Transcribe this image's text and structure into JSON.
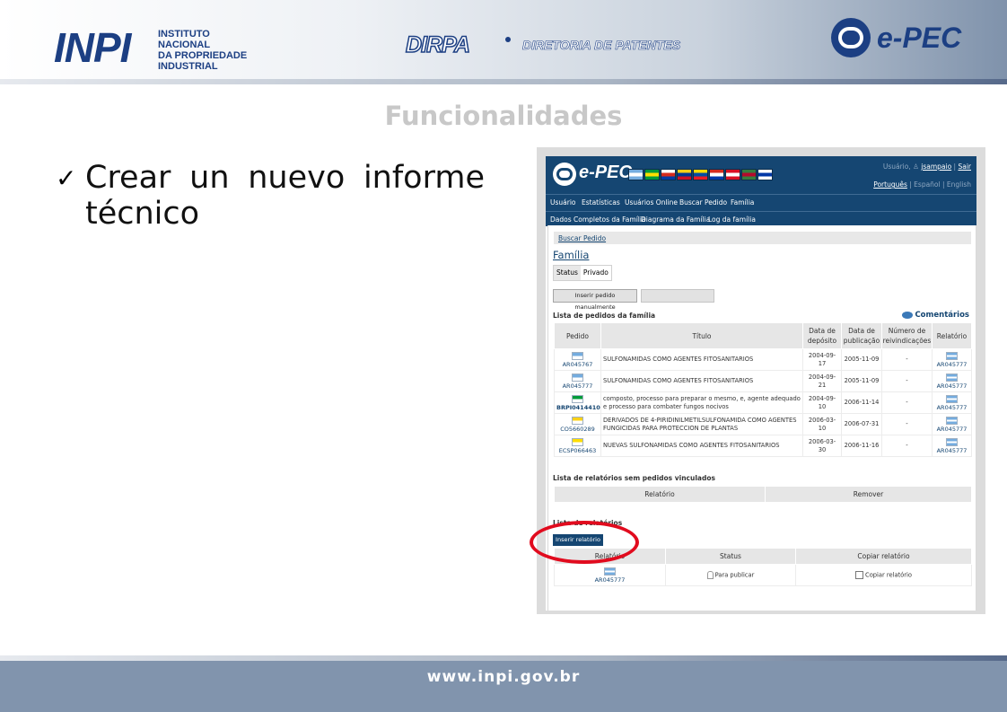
{
  "header": {
    "inpi_logo": "INPI",
    "inpi_lines": [
      "INSTITUTO",
      "NACIONAL",
      "DA PROPRIEDADE",
      "INDUSTRIAL"
    ],
    "dirpa": "DIRPA",
    "dirpa_sub": "DIRETORIA DE PATENTES",
    "epec": "e-PEC"
  },
  "slide": {
    "title": "Funcionalidades",
    "bullet": "Crear un nuevo informe técnico",
    "check_glyph": "✓"
  },
  "app": {
    "logo": "e-PEC",
    "flags": [
      {
        "country": "AR",
        "c1": "#74acdf",
        "c2": "#ffffff",
        "c3": "#74acdf"
      },
      {
        "country": "BR",
        "c1": "#009b3a",
        "c2": "#fedf00",
        "c3": "#009b3a"
      },
      {
        "country": "CL",
        "c1": "#ffffff",
        "c2": "#d52b1e",
        "c3": "#0039a6"
      },
      {
        "country": "CO",
        "c1": "#fcd116",
        "c2": "#003893",
        "c3": "#ce1126"
      },
      {
        "country": "EC",
        "c1": "#ffdd00",
        "c2": "#034ea2",
        "c3": "#ed1c24"
      },
      {
        "country": "PY",
        "c1": "#d52b1e",
        "c2": "#ffffff",
        "c3": "#0038a8"
      },
      {
        "country": "PE",
        "c1": "#d91023",
        "c2": "#ffffff",
        "c3": "#d91023"
      },
      {
        "country": "SR",
        "c1": "#377e3f",
        "c2": "#b40a2d",
        "c3": "#377e3f"
      },
      {
        "country": "UY",
        "c1": "#ffffff",
        "c2": "#0038a8",
        "c3": "#ffffff"
      }
    ],
    "user_label": "Usuário,",
    "user_name": "jsampaio",
    "logout": "Sair",
    "langs": {
      "pt": "Português",
      "es": "Español",
      "en": "English"
    },
    "menu1": [
      "Usuário",
      "Estatísticas",
      "Usuários Online",
      "Buscar Pedido",
      "Família"
    ],
    "menu2": [
      "Dados Completos da Família",
      "Diagrama da Família",
      "Log da família"
    ],
    "breadcrumb": "Buscar Pedido",
    "family_title": "Família",
    "status_label": "Status",
    "status_value": "Privado",
    "insert_pedido_btn": "Inserir pedido manualmente",
    "list_pedidos_title": "Lista de pedidos da família",
    "comments": "Comentários",
    "table": {
      "headers": [
        "Pedido",
        "Título",
        "Data de depósito",
        "Data de publicação",
        "Número de reivindicações",
        "Relatório"
      ],
      "rows": [
        {
          "pedido": "AR045767",
          "flag": "#74acdf",
          "bold": false,
          "titulo": "SULFONAMIDAS COMO AGENTES FITOSANITARIOS",
          "deposito": "2004-09-17",
          "publicacao": "2005-11-09",
          "reivindicacoes": "-",
          "relatorio": "AR045777"
        },
        {
          "pedido": "AR045777",
          "flag": "#74acdf",
          "bold": false,
          "titulo": "SULFONAMIDAS COMO AGENTES FITOSANITARIOS",
          "deposito": "2004-09-21",
          "publicacao": "2005-11-09",
          "reivindicacoes": "-",
          "relatorio": "AR045777"
        },
        {
          "pedido": "BRPI0414410",
          "flag": "#009b3a",
          "bold": true,
          "titulo": "composto, processo para preparar o mesmo, e, agente adequado e processo para combater fungos nocivos",
          "deposito": "2004-09-10",
          "publicacao": "2006-11-14",
          "reivindicacoes": "-",
          "relatorio": "AR045777"
        },
        {
          "pedido": "CO5660289",
          "flag": "#fcd116",
          "bold": false,
          "titulo": "DERIVADOS DE 4-PIRIDINILMETILSULFONAMIDA COMO AGENTES FUNGICIDAS PARA PROTECCION DE PLANTAS",
          "deposito": "2006-03-10",
          "publicacao": "2006-07-31",
          "reivindicacoes": "-",
          "relatorio": "AR045777"
        },
        {
          "pedido": "ECSP066463",
          "flag": "#ffdd00",
          "bold": false,
          "titulo": "NUEVAS SULFONAMIDAS COMO AGENTES FITOSANITARIOS",
          "deposito": "2006-03-30",
          "publicacao": "2006-11-16",
          "reivindicacoes": "-",
          "relatorio": "AR045777"
        }
      ]
    },
    "orphan_title": "Lista de relatórios sem pedidos vinculados",
    "orphan_headers": [
      "Relatório",
      "Remover"
    ],
    "rel_list_title": "Lista de relatórios",
    "insert_rel_btn": "Inserir relatório",
    "rel_headers": [
      "Relatório",
      "Status",
      "Copiar relatório"
    ],
    "rel_row": {
      "relatorio": "AR045777",
      "flag": "#74acdf",
      "status": "Para publicar",
      "copiar": "Copiar relatório"
    }
  },
  "footer": {
    "url": "www.inpi.gov.br"
  },
  "colors": {
    "brand_blue": "#1c3f83",
    "app_nav": "#154672",
    "highlight_red": "#e10b1e",
    "title_gray": "#c8c8c8"
  }
}
